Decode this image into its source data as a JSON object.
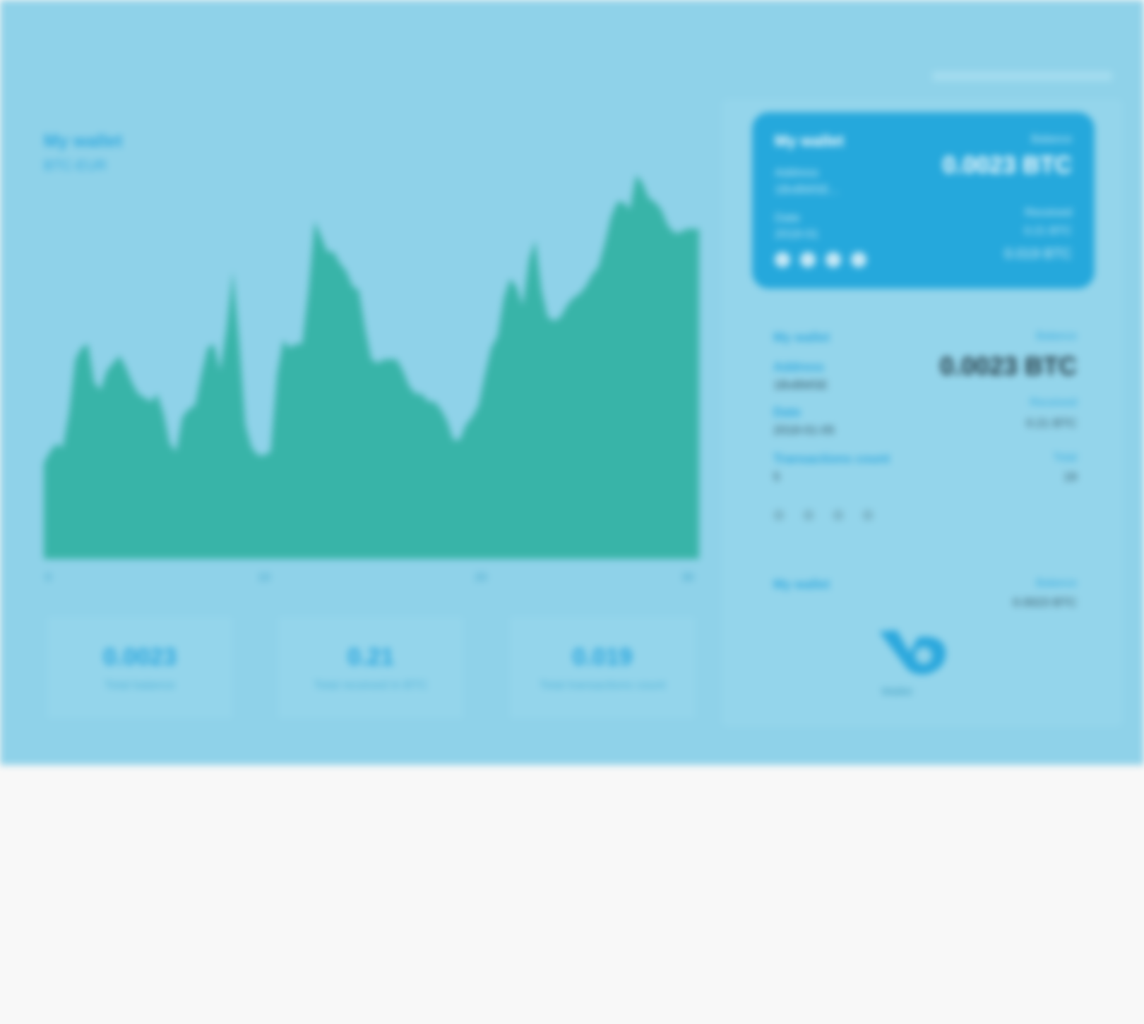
{
  "chart": {
    "title": "My wallet",
    "subtitle": "BTC-EUR",
    "x_ticks": [
      "0",
      "10",
      "20",
      "30"
    ],
    "fill_color": "#38b4a8"
  },
  "chart_data": {
    "type": "area",
    "title": "My wallet",
    "subtitle": "BTC-EUR",
    "xlabel": "",
    "ylabel": "",
    "x_ticks": [
      "0",
      "10",
      "20",
      "30"
    ],
    "ylim": [
      0,
      1
    ],
    "values": [
      0.25,
      0.28,
      0.3,
      0.29,
      0.38,
      0.52,
      0.55,
      0.56,
      0.46,
      0.44,
      0.49,
      0.51,
      0.53,
      0.5,
      0.46,
      0.43,
      0.42,
      0.41,
      0.43,
      0.38,
      0.3,
      0.28,
      0.37,
      0.39,
      0.4,
      0.48,
      0.55,
      0.56,
      0.49,
      0.6,
      0.75,
      0.57,
      0.35,
      0.29,
      0.27,
      0.27,
      0.28,
      0.48,
      0.57,
      0.55,
      0.56,
      0.56,
      0.7,
      0.88,
      0.84,
      0.8,
      0.8,
      0.77,
      0.75,
      0.71,
      0.7,
      0.6,
      0.52,
      0.51,
      0.52,
      0.52,
      0.52,
      0.49,
      0.45,
      0.43,
      0.43,
      0.41,
      0.41,
      0.39,
      0.36,
      0.31,
      0.31,
      0.35,
      0.37,
      0.4,
      0.48,
      0.55,
      0.58,
      0.68,
      0.73,
      0.71,
      0.66,
      0.78,
      0.83,
      0.7,
      0.63,
      0.62,
      0.63,
      0.66,
      0.68,
      0.69,
      0.71,
      0.74,
      0.76,
      0.82,
      0.89,
      0.93,
      0.93,
      0.91,
      1.0,
      0.98,
      0.94,
      0.93,
      0.91,
      0.87,
      0.85,
      0.85,
      0.86,
      0.86,
      0.86
    ],
    "grid": false
  },
  "stats": [
    {
      "value": "0.0023",
      "caption": "Total balance"
    },
    {
      "value": "0.21",
      "caption": "Total received in BTC"
    },
    {
      "value": "0.019",
      "caption": "Total transactions count"
    }
  ],
  "card": {
    "name": "My wallet",
    "balance_label": "Balance",
    "balance": "0.0023 BTC",
    "address_label": "Address",
    "address": "1BvBMSE...",
    "date_label": "Date",
    "date": "2018-01",
    "right_line1": "Received",
    "right_line2": "0.21 BTC",
    "right_line3": "0.019 BTC"
  },
  "detail": {
    "name": "My wallet",
    "balance_label": "Balance",
    "balance": "0.0023 BTC",
    "address_label": "Address",
    "address": "1BvBMSE",
    "date_label": "Date",
    "date": "2018-01-05",
    "received_label": "Received",
    "received": "0.21 BTC",
    "transactions_label": "Transactions count",
    "transactions": "5",
    "transactions_total_label": "Total",
    "transactions_total": "19"
  },
  "list2": {
    "name": "My wallet",
    "balance_label": "Balance",
    "balance": "0.0023 BTC"
  },
  "logo": {
    "caption": "Wallet",
    "color": "#2ba8dd"
  }
}
